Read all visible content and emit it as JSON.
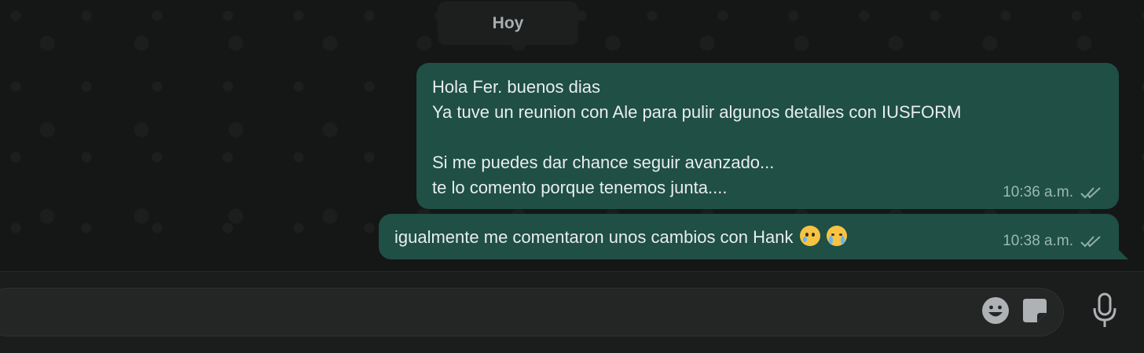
{
  "date_divider": "Hoy",
  "messages": [
    {
      "lines": [
        "Hola Fer. buenos dias",
        "Ya tuve un reunion con Ale para pulir algunos detalles con IUSFORM",
        "",
        "Si me puedes dar chance seguir avanzado...",
        "te lo comento porque tenemos junta...."
      ],
      "time": "10:36 a.m.",
      "status": "double-check-icon"
    },
    {
      "text": "igualmente me comentaron unos cambios con Hank",
      "emojis": [
        "face-holding-back-tears-icon",
        "loudly-crying-face-icon"
      ],
      "time": "10:38 a.m.",
      "status": "double-check-icon"
    }
  ],
  "composer": {
    "icons": [
      "emoji-icon",
      "sticker-icon",
      "microphone-icon"
    ]
  },
  "colors": {
    "outgoing_bubble": "#1f4f45",
    "background": "#151616",
    "text": "#e9edef"
  }
}
